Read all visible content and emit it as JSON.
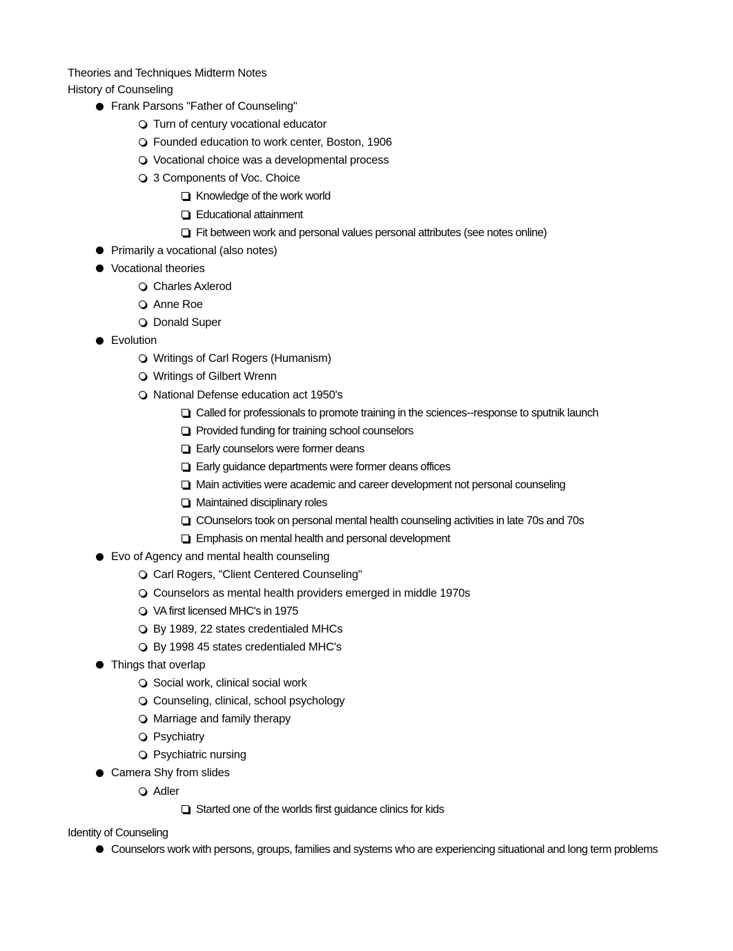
{
  "document": {
    "title": "Theories and Techniques Midterm Notes",
    "sections": [
      {
        "heading": "History of Counseling",
        "items": [
          {
            "text": "Frank Parsons \"Father of Counseling\"",
            "children": [
              {
                "text": "Turn of century vocational educator"
              },
              {
                "text": "Founded education to work center, Boston, 1906"
              },
              {
                "text": "Vocational choice was a developmental process"
              },
              {
                "text": "3 Components of Voc. Choice",
                "children": [
                  {
                    "text": "Knowledge of the work world"
                  },
                  {
                    "text": "Educational attainment"
                  },
                  {
                    "text": "Fit between work and personal values personal attributes (see notes online)"
                  }
                ]
              }
            ]
          },
          {
            "text": "Primarily a vocational (also notes)"
          },
          {
            "text": "Vocational theories",
            "children": [
              {
                "text": "Charles Axlerod"
              },
              {
                "text": "Anne Roe"
              },
              {
                "text": "Donald Super"
              }
            ]
          },
          {
            "text": "Evolution",
            "children": [
              {
                "text": "Writings of Carl Rogers (Humanism)"
              },
              {
                "text": "Writings of Gilbert Wrenn"
              },
              {
                "text": "National Defense education act 1950's",
                "children": [
                  {
                    "text": "Called for professionals to promote training in the sciences--response to sputnik launch"
                  },
                  {
                    "text": "Provided funding for training school counselors"
                  },
                  {
                    "text": "Early counselors were former deans"
                  },
                  {
                    "text": "Early guidance departments were former deans offices"
                  },
                  {
                    "text": "Main activities were academic and career development not personal counseling"
                  },
                  {
                    "text": "Maintained disciplinary roles"
                  },
                  {
                    "text": "COunselors took on personal mental health counseling activities in late 70s and 70s"
                  },
                  {
                    "text": "Emphasis on mental health and personal development"
                  }
                ]
              }
            ]
          },
          {
            "text": "Evo of Agency and mental health counseling",
            "children": [
              {
                "text": "Carl Rogers, \"Client Centered Counseling\""
              },
              {
                "text": "Counselors as mental health providers emerged in middle 1970s"
              },
              {
                "text": "VA first licensed MHC's in 1975"
              },
              {
                "text": "By 1989, 22 states credentialed MHCs"
              },
              {
                "text": "By 1998 45 states credentialed MHC's"
              }
            ]
          },
          {
            "text": "Things that overlap",
            "children": [
              {
                "text": "Social work, clinical social work"
              },
              {
                "text": "Counseling, clinical, school psychology"
              },
              {
                "text": "Marriage and family therapy"
              },
              {
                "text": "Psychiatry"
              },
              {
                "text": "Psychiatric nursing"
              }
            ]
          },
          {
            "text": "Camera Shy from slides",
            "children": [
              {
                "text": "Adler",
                "children": [
                  {
                    "text": "Started one of the worlds first guidance clinics for kids"
                  }
                ]
              }
            ]
          }
        ]
      },
      {
        "heading": "Identity of Counseling",
        "items": [
          {
            "text": "Counselors work with persons, groups, families and systems who are experiencing situational and long term problems"
          }
        ]
      }
    ]
  },
  "icons": {
    "level1": "filled-disc-bullet",
    "level2": "shadowed-circle-bullet",
    "level3": "shadowed-square-bullet"
  }
}
